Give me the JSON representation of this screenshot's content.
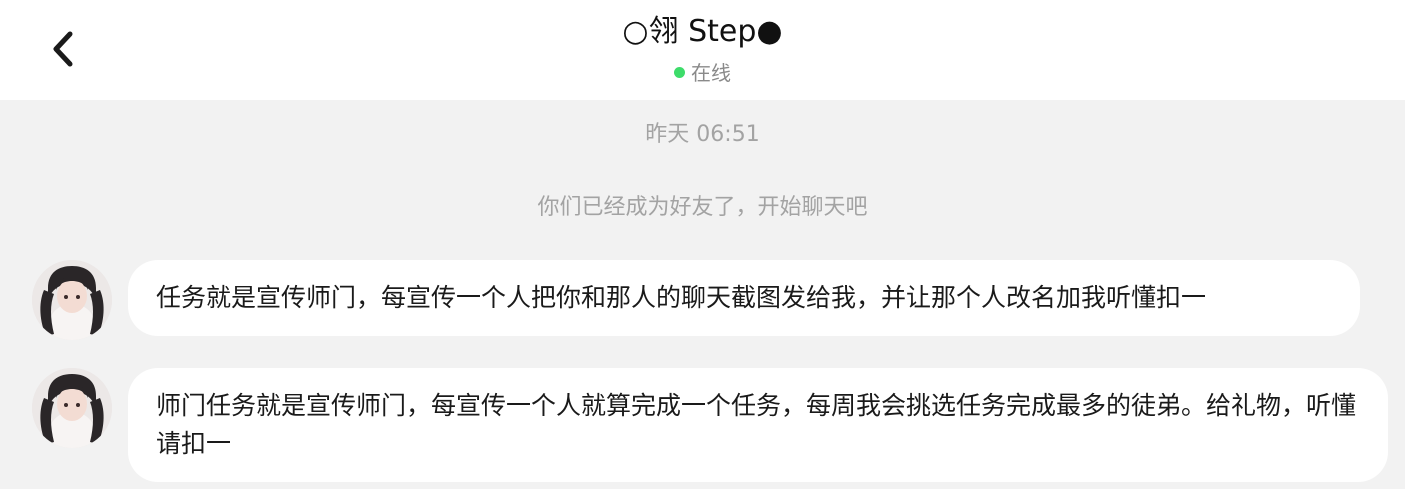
{
  "header": {
    "back_icon": "chevron-left-icon",
    "title": "○翎 Step●",
    "status_text": "在线",
    "status_color": "#3ddc6a"
  },
  "chat": {
    "timestamp": "昨天 06:51",
    "system_note": "你们已经成为好友了，开始聊天吧",
    "messages": [
      {
        "sender": "contact",
        "avatar_icon": "avatar-photo",
        "text": "任务就是宣传师门，每宣传一个人把你和那人的聊天截图发给我，并让那个人改名加我听懂扣一"
      },
      {
        "sender": "contact",
        "avatar_icon": "avatar-photo",
        "text": "师门任务就是宣传师门，每宣传一个人就算完成一个任务，每周我会挑选任务完成最多的徒弟。给礼物，听懂请扣一"
      }
    ]
  },
  "colors": {
    "background": "#f2f2f2",
    "header_background": "#ffffff",
    "bubble_background": "#ffffff",
    "muted_text": "#a3a3a3"
  }
}
